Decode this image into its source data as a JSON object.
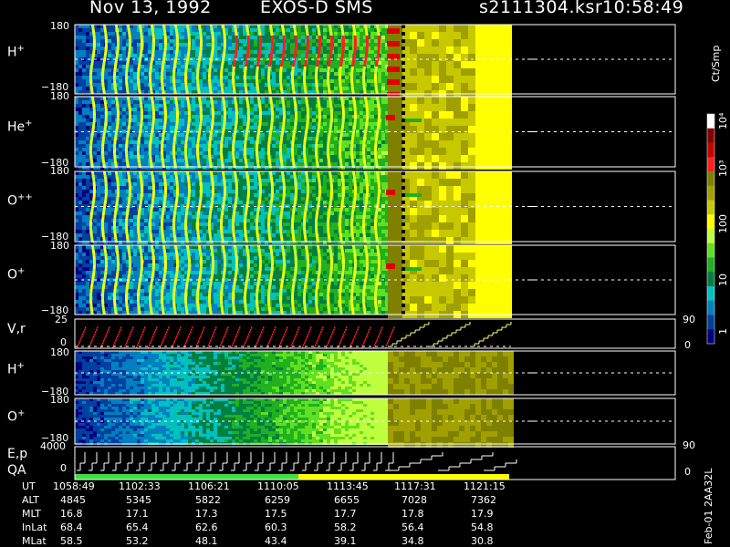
{
  "header": {
    "date": "Nov 13, 1992",
    "instrument": "EXOS-D SMS",
    "file": "s2111304.ksr",
    "time": "10:58:49"
  },
  "panels": [
    {
      "label": "H",
      "sup": "+",
      "top": "180",
      "bottom": "−180"
    },
    {
      "label": "He",
      "sup": "+",
      "top": "180",
      "bottom": "−180"
    },
    {
      "label": "O",
      "sup": "++",
      "top": "180",
      "bottom": "−180"
    },
    {
      "label": "O",
      "sup": "+",
      "top": "180",
      "bottom": "−180"
    }
  ],
  "vr_panel": {
    "label": "V,r",
    "top": "25",
    "zero": "0",
    "right_top": "90",
    "right_bottom": "0"
  },
  "pitch_panels": [
    {
      "label": "H",
      "sup": "+",
      "top": "180",
      "bottom": "−180"
    },
    {
      "label": "O",
      "sup": "+",
      "top": "180",
      "bottom": "−180"
    }
  ],
  "ep_panel": {
    "label1": "E,p",
    "label2": "QA",
    "top": "4000",
    "zero": "0",
    "right_top": "90",
    "right_bottom": "0"
  },
  "colorbar": {
    "units": "Ct/Smp",
    "ticks": [
      "10⁴",
      "10³",
      "100",
      "10",
      "1"
    ],
    "colors": [
      "#ffffff",
      "#8a0000",
      "#c80000",
      "#ff2020",
      "#808000",
      "#a0a000",
      "#c8c800",
      "#ffff00",
      "#c0ff40",
      "#60e020",
      "#20b020",
      "#008040",
      "#00c0c0",
      "#0080c0",
      "#0040a0",
      "#000080"
    ]
  },
  "ephemeris": {
    "rows": [
      "UT",
      "ALT",
      "MLT",
      "InLat",
      "MLat"
    ],
    "columns": [
      [
        "1058:49",
        "4845",
        "16.8",
        "68.4",
        "58.5"
      ],
      [
        "1102:33",
        "5345",
        "17.1",
        "65.4",
        "53.2"
      ],
      [
        "1106:21",
        "5822",
        "17.3",
        "62.6",
        "48.1"
      ],
      [
        "1110:05",
        "6259",
        "17.5",
        "60.3",
        "43.4"
      ],
      [
        "1113:45",
        "6655",
        "17.7",
        "58.2",
        "39.1"
      ],
      [
        "1117:31",
        "7028",
        "17.8",
        "56.4",
        "34.8"
      ],
      [
        "1121:15",
        "7362",
        "17.9",
        "54.8",
        "30.8"
      ]
    ]
  },
  "footer_code": "Feb-01 2AA32L"
}
